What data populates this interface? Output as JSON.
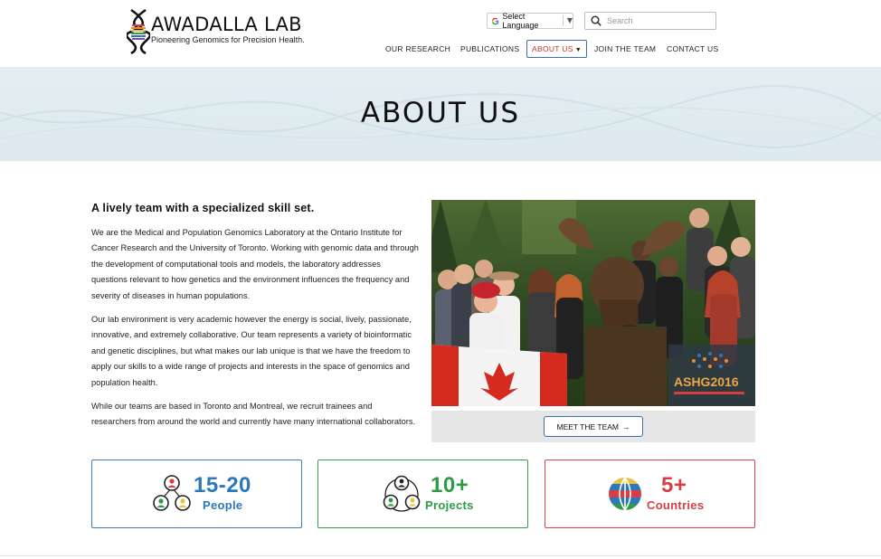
{
  "header": {
    "logo_title": "AWADALLA LAB",
    "logo_tagline": "Pioneering Genomics for Precision Health.",
    "language_label": "Select Language",
    "search_placeholder": "Search",
    "nav": [
      {
        "label": "OUR RESEARCH"
      },
      {
        "label": "PUBLICATIONS"
      },
      {
        "label": "ABOUT US",
        "active": true
      },
      {
        "label": "JOIN THE TEAM"
      },
      {
        "label": "CONTACT US"
      }
    ]
  },
  "hero": {
    "title": "ABOUT US"
  },
  "intro": {
    "heading": "A lively team with a specialized skill set.",
    "paragraphs": [
      "We are the Medical and Population Genomics Laboratory at the Ontario Institute for Cancer Research and the University of Toronto. Working with genomic data and through the development of computational tools and models, the laboratory addresses questions relevant to how genetics and the environment influences the frequency and severity of diseases in human populations.",
      "Our lab environment is very academic however the energy is social, lively, passionate, innovative, and extremely collaborative. Our team represents a variety of bioinformatic and genetic disciplines, but what makes our lab unique is that we have the freedom to apply our skills to a wide range of projects and interests in the space of genomics and population health.",
      "While our teams are based in Toronto and Montreal, we recruit trainees and researchers from around the world and currently have many international collaborators."
    ]
  },
  "photo": {
    "banner_text": "ASHG2016"
  },
  "team_button": {
    "label": "MEET THE TEAM",
    "arrow": "→"
  },
  "stats": [
    {
      "number": "15-20",
      "label": "People",
      "icon": "people-icon",
      "color": "#2b78c0"
    },
    {
      "number": "10+",
      "label": "Projects",
      "icon": "network-icon",
      "color": "#2f9a45"
    },
    {
      "number": "5+",
      "label": "Countries",
      "icon": "globe-icon",
      "color": "#d63d45"
    }
  ],
  "colors": {
    "accent_blue": "#3a6fb0",
    "active_red": "#c4342d",
    "hero_bg": "#e4eef3"
  }
}
